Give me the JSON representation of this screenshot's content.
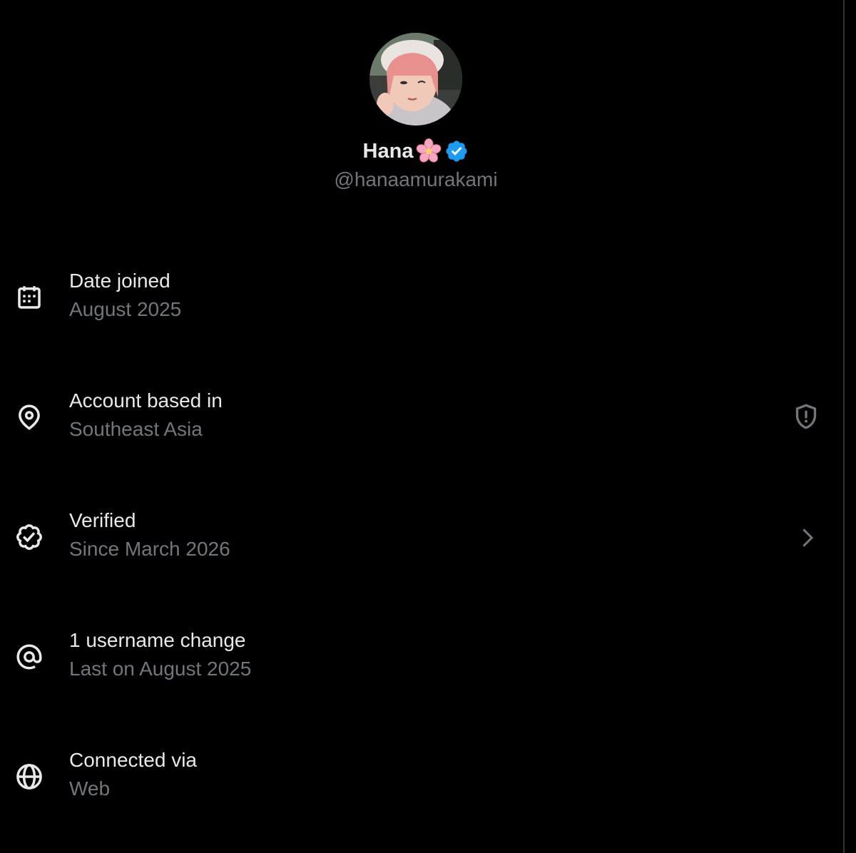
{
  "profile": {
    "display_name": "Hana",
    "name_emoji": "cherry-blossom",
    "verified_badge": "verified-badge-icon",
    "handle": "@hanaamurakami"
  },
  "rows": [
    {
      "icon": "calendar-icon",
      "title": "Date joined",
      "subtitle": "August 2025"
    },
    {
      "icon": "location-pin-icon",
      "title": "Account based in",
      "subtitle": "Southeast Asia",
      "action_icon": "shield-alert-icon"
    },
    {
      "icon": "verified-outline-icon",
      "title": "Verified",
      "subtitle": "Since March 2026",
      "action_icon": "chevron-right-icon"
    },
    {
      "icon": "at-sign-icon",
      "title": "1 username change",
      "subtitle": "Last on August 2025"
    },
    {
      "icon": "globe-icon",
      "title": "Connected via",
      "subtitle": "Web"
    }
  ],
  "colors": {
    "background": "#000000",
    "primary_text": "#e7e9ea",
    "secondary_text": "#71767b",
    "verified_blue": "#1d9bf0",
    "border": "#2f3336"
  }
}
